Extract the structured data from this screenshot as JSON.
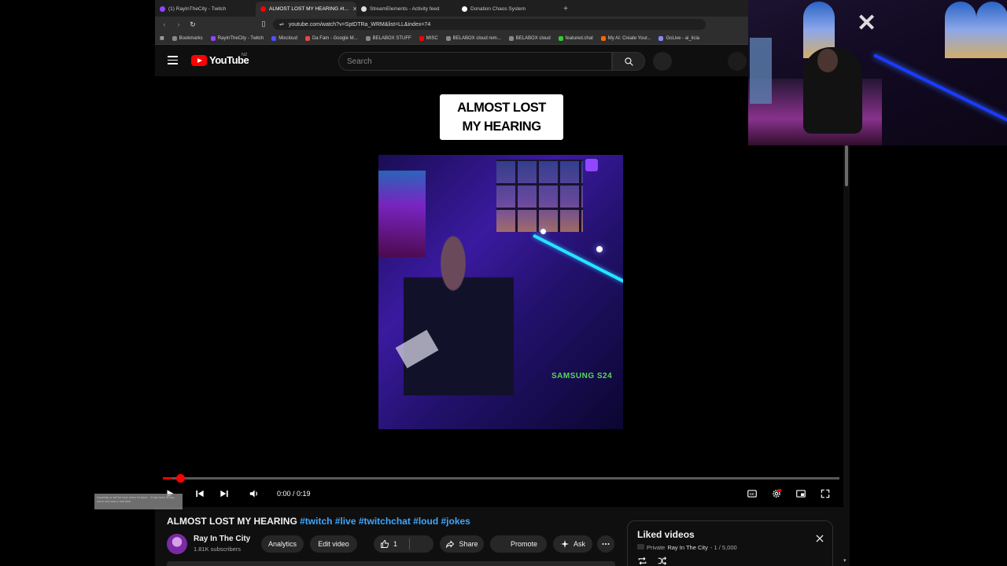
{
  "browser": {
    "tabs": [
      {
        "label": "(1) RayInTheCity - Twitch",
        "color": "#9146ff",
        "active": false
      },
      {
        "label": "ALMOST LOST MY HEARING #t…",
        "color": "#ff0000",
        "active": true
      },
      {
        "label": "StreamElements - Activity feed",
        "color": "#dddddd",
        "active": false
      },
      {
        "label": "Donation Chaos System",
        "color": "#ffffff",
        "active": false
      }
    ],
    "url": "youtube.com/watch?v=SptDTRa_WRM&list=LL&index=74",
    "bookmarks": [
      "Bookmarks",
      "RayInTheCity - Twitch",
      "Mixcloud",
      "Da Fam - Google M...",
      "BELABOX STUFF",
      "MISC",
      "BELABOX cloud rem...",
      "BELABOX cloud",
      "featured.chat",
      "My AI: Create Your...",
      "GoLive - ai_licia"
    ]
  },
  "youtube": {
    "logo_text": "YouTube",
    "country": "NZ",
    "search_placeholder": "Search"
  },
  "video": {
    "overlay_title_line1": "ALMOST LOST",
    "overlay_title_line2": "MY HEARING",
    "watermark": "SAMSUNG S24",
    "time": "0:00 / 0:19",
    "progress": 0.0
  },
  "watch": {
    "title": "ALMOST LOST MY HEARING",
    "hashtags": "#twitch #live #twitchchat #loud #jokes",
    "channel": "Ray In The City",
    "subscribers": "1.81K subscribers",
    "buttons": {
      "analytics": "Analytics",
      "edit": "Edit video",
      "likes": "1",
      "share": "Share",
      "promote": "Promote",
      "ask": "Ask"
    }
  },
  "playlist": {
    "title": "Liked videos",
    "privacy": "Private",
    "owner": "Ray In The City",
    "position": "- 1 / 5,000"
  },
  "chat_bubble": "hopefully ur will be here when im back... it has been a very much and was a real time",
  "colors": {
    "accent": "#ff0000",
    "link": "#3ea6ff",
    "background": "#0f0f0f"
  }
}
